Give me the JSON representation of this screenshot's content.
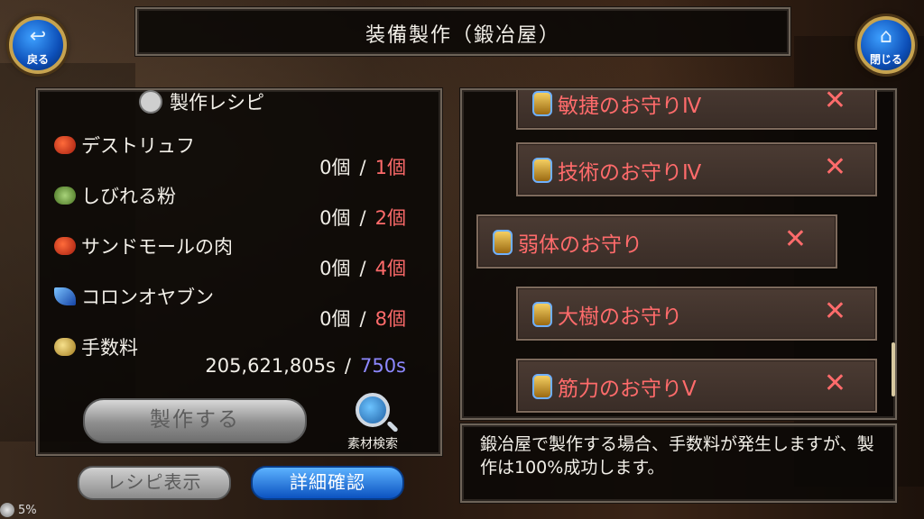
{
  "header": {
    "title": "装備製作（鍛冶屋）"
  },
  "nav": {
    "back": {
      "label": "戻る",
      "icon": "back-arrow-icon"
    },
    "close": {
      "label": "閉じる",
      "icon": "home-icon"
    }
  },
  "recipe": {
    "title": "製作レシピ",
    "materials": [
      {
        "name": "デストリュフ",
        "have": "0個",
        "need": "1個",
        "icon": "mushroom-icon"
      },
      {
        "name": "しびれる粉",
        "have": "0個",
        "need": "2個",
        "icon": "pouch-icon"
      },
      {
        "name": "サンドモールの肉",
        "have": "0個",
        "need": "4個",
        "icon": "meat-icon"
      },
      {
        "name": "コロンオヤブン",
        "have": "0個",
        "need": "8個",
        "icon": "feather-icon"
      }
    ],
    "fee": {
      "name": "手数料",
      "have": "205,621,805s",
      "need": "750s",
      "icon": "coin-icon"
    },
    "separator": "/",
    "craft_button": "製作する",
    "search_label": "素材検索"
  },
  "bottom_buttons": {
    "recipe_display": "レシピ表示",
    "detail": "詳細確認"
  },
  "list": {
    "items": [
      {
        "name": "敏捷のお守りⅣ",
        "mark": "✕"
      },
      {
        "name": "技術のお守りⅣ",
        "mark": "✕"
      },
      {
        "name": "弱体のお守り",
        "mark": "✕"
      },
      {
        "name": "大樹のお守り",
        "mark": "✕"
      },
      {
        "name": "筋力のお守りⅤ",
        "mark": "✕"
      }
    ]
  },
  "info": {
    "text": "鍛冶屋で製作する場合、手数料が発生しますが、製作は100%成功します。"
  },
  "status": {
    "percent": "5%"
  },
  "colors": {
    "need": "#ff6b6b",
    "fee": "#8d88ff",
    "accent_blue": "#0b52c0",
    "frame_gold": "#c6a350"
  }
}
